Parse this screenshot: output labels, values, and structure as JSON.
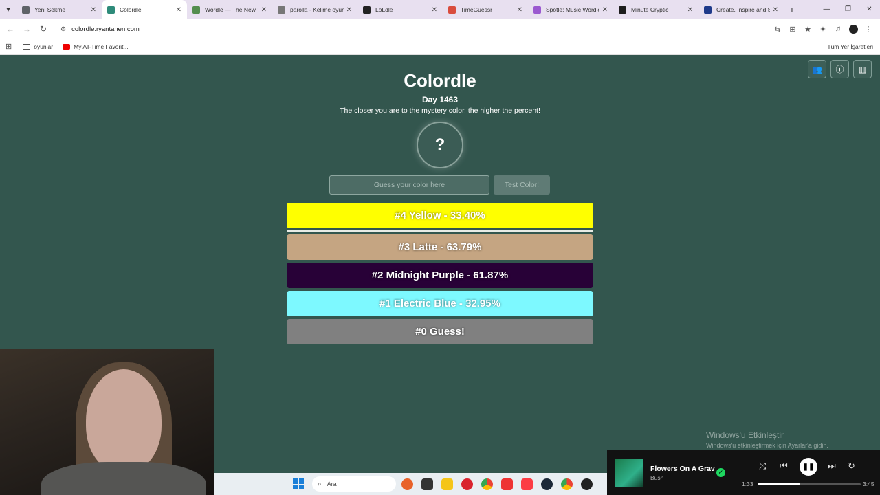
{
  "browser": {
    "tabs": [
      {
        "title": "Yeni Sekme",
        "favicon_color": "#5f6368"
      },
      {
        "title": "Colordle",
        "favicon_color": "#2e8b7a"
      },
      {
        "title": "Wordle — The New Y",
        "favicon_color": "#538d4e"
      },
      {
        "title": "parolla - Kelime oyun",
        "favicon_color": "#777777"
      },
      {
        "title": "LoLdle",
        "favicon_color": "#222222"
      },
      {
        "title": "TimeGuessr",
        "favicon_color": "#d94c3d"
      },
      {
        "title": "Spotle: Music Wordle",
        "favicon_color": "#9b59d0"
      },
      {
        "title": "Minute Cryptic",
        "favicon_color": "#1d1d1d"
      },
      {
        "title": "Create, Inspire and Sh",
        "favicon_color": "#1f3a8a"
      }
    ],
    "active_tab_index": 1,
    "url": "colordle.ryantanen.com",
    "bookmarks": [
      {
        "label": "oyunlar",
        "icon": "folder-icon"
      },
      {
        "label": "My All-Time Favorit...",
        "icon": "youtube-icon"
      }
    ],
    "all_bookmarks_label": "Tüm Yer İşaretleri"
  },
  "game": {
    "title": "Colordle",
    "day": "Day 1463",
    "subtitle": "The closer you are to the mystery color, the higher the percent!",
    "mystery_symbol": "?",
    "input_placeholder": "Guess your color here",
    "test_button": "Test Color!",
    "guesses": [
      {
        "label": "#4 Yellow - 33.40%",
        "color": "#ffff00"
      },
      {
        "label": "#3 Latte - 63.79%",
        "color": "#c5a582"
      },
      {
        "label": "#2 Midnight Purple - 61.87%",
        "color": "#280137"
      },
      {
        "label": "#1 Electric Blue - 32.95%",
        "color": "#7df9ff"
      },
      {
        "label": "#0 Guess!",
        "color": "#808080"
      }
    ]
  },
  "taskbar": {
    "search_label": "Ara"
  },
  "watermark": {
    "title": "Windows'u Etkinleştir",
    "subtitle": "Windows'u etkinleştirmek için Ayarlar'a gidin."
  },
  "player": {
    "song": "Flowers On A Grav",
    "artist": "Bush",
    "current_time": "1:33",
    "total_time": "3:45",
    "progress_fraction": 0.41
  }
}
